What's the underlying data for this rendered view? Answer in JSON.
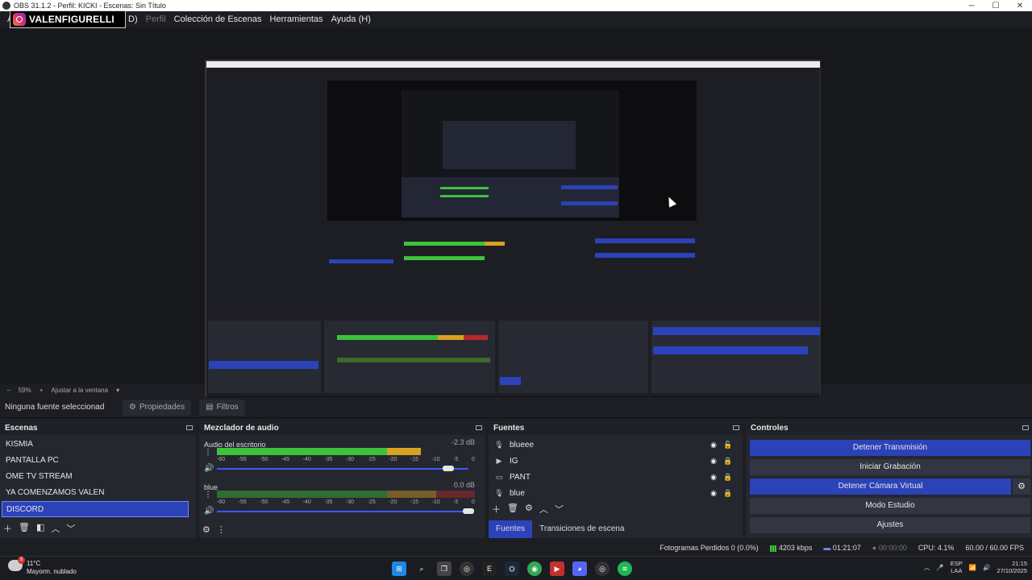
{
  "window": {
    "title": "OBS 31.1.2 - Perfil: KICKI - Escenas: Sin Título",
    "controls": [
      "─",
      "☐",
      "✕"
    ]
  },
  "menu": [
    "A",
    "D)",
    "Perfil",
    "Colección de Escenas",
    "Herramientas",
    "Ayuda (H)"
  ],
  "watermark": {
    "handle": "VALENFIGURELLI"
  },
  "zoom": {
    "percent": "59%",
    "fit_label": "Ajustar a la ventana",
    "minus": "−",
    "plus": "+"
  },
  "props_bar": {
    "no_source": "Ninguna fuente seleccionad",
    "properties": "Propiedades",
    "filters": "Filtros"
  },
  "scenes": {
    "title": "Escenas",
    "items": [
      "KISMIA",
      "PANTALLA PC",
      "OME TV STREAM",
      "YA COMENZAMOS VALEN",
      "DISCORD"
    ],
    "selected_index": 4
  },
  "mixer": {
    "title": "Mezclador de audio",
    "ticks": [
      "-60",
      "-55",
      "-50",
      "-45",
      "-40",
      "-35",
      "-30",
      "-25",
      "-20",
      "-15",
      "-10",
      "-5",
      "0"
    ],
    "channels": [
      {
        "name": "Audio del escritorio",
        "db": "-2.3 dB",
        "level": 0.79,
        "volume": 0.92
      },
      {
        "name": "blue",
        "db": "0.0 dB",
        "level": 0.0,
        "volume": 1.0
      }
    ]
  },
  "sources": {
    "title": "Fuentes",
    "items": [
      {
        "name": "blueee",
        "icon": "mic-icon",
        "locked": false
      },
      {
        "name": "IG",
        "icon": "play-icon",
        "locked": true
      },
      {
        "name": "PANT",
        "icon": "monitor-icon",
        "locked": true
      },
      {
        "name": "blue",
        "icon": "mic-icon",
        "locked": true
      }
    ],
    "tabs": [
      "Fuentes",
      "Transiciones de escena"
    ]
  },
  "controls": {
    "title": "Controles",
    "buttons": [
      "Detener Transmisión",
      "Iniciar Grabación",
      "Detener Cámara Virtual",
      "Modo Estudio",
      "Ajustes"
    ],
    "active": [
      true,
      false,
      true,
      false,
      false
    ]
  },
  "status": {
    "dropped": "Fotogramas Perdidos 0 (0.0%)",
    "bitrate": "4203 kbps",
    "stream_time": "01:21:07",
    "rec_time": "00:00:00",
    "cpu": "CPU: 4.1%",
    "fps": "60.00 / 60.00 FPS"
  },
  "taskbar": {
    "weather_temp": "11°C",
    "weather_desc": "Mayorm. nublado",
    "weather_badge": "5",
    "lang_top": "ESP",
    "lang_bottom": "LAA",
    "time": "21:15",
    "date": "27/10/2025"
  },
  "colors": {
    "accent": "#2b42b8",
    "meter_green": "#3bc33b",
    "meter_yellow": "#d8a221",
    "meter_red": "#b62a2a"
  }
}
